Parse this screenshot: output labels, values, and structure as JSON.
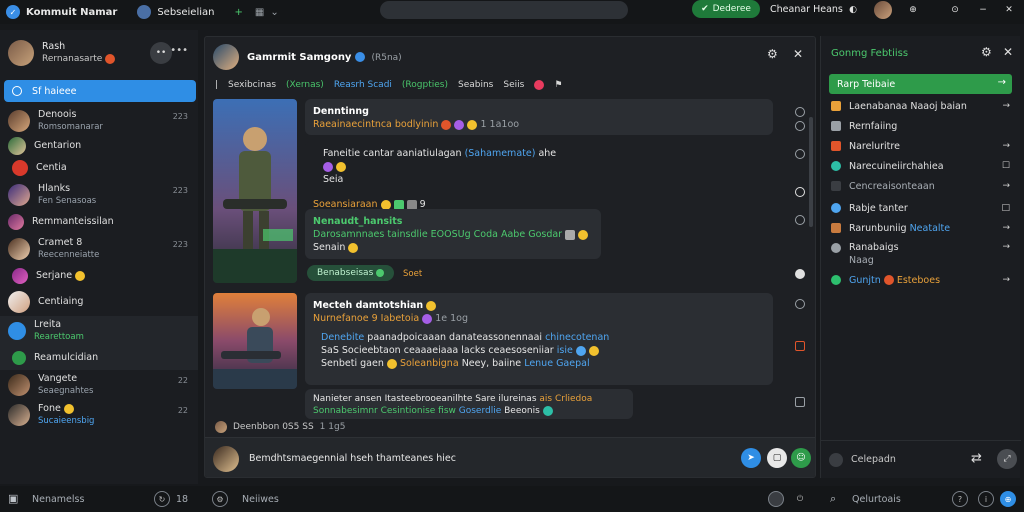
{
  "topbar": {
    "app_title": "Kommuit Namar",
    "server_name": "Sebseielian",
    "green_button": "Dederee",
    "channel_name": "Cheanar Heans"
  },
  "sidebar": {
    "profile_name": "Rash",
    "profile_sub": "Rernanasarte",
    "active_item": "Sf haieee",
    "items": [
      {
        "label": "Denoois",
        "sub": "Romsomanarar",
        "count": "223"
      },
      {
        "label": "Gentarion",
        "sub": "",
        "count": ""
      },
      {
        "label": "Centia",
        "sub": "",
        "count": ""
      },
      {
        "label": "Hlanks",
        "sub": "Fen Senasoas",
        "count": "223"
      },
      {
        "label": "Remmanteissilan",
        "sub": "",
        "count": ""
      },
      {
        "label": "Cramet 8",
        "sub": "Reecenneiatte",
        "count": "223"
      },
      {
        "label": "Serjane",
        "sub": "",
        "count": ""
      },
      {
        "label": "Centiaing",
        "sub": "",
        "count": ""
      },
      {
        "label": "Lreita",
        "sub": "Rearettoam",
        "count": ""
      },
      {
        "label": "Reamulcidian",
        "sub": "",
        "count": ""
      },
      {
        "label": "Vangete",
        "sub": "Seaegnahtes",
        "count": "22"
      },
      {
        "label": "Fone",
        "sub": "Sucaieensbig",
        "count": "22"
      }
    ]
  },
  "bottombar": {
    "left_label": "Nenamelss",
    "count": "18",
    "middle_label": "Neiiwes",
    "right_label": "Qelurtoais"
  },
  "main": {
    "user_name": "Gamrmit Samgony",
    "handle": "(R5na)",
    "tags": [
      "Sexibcinas",
      "(Xernas)",
      "Reasrh Scadi",
      "(Rogpties)",
      "Seabins",
      "Seiis"
    ],
    "post1": {
      "title": "Denntinng",
      "line1": "Raeainaecintnca bodlyinin",
      "line1_tail": "1 1a1oo",
      "body": "Faneitie cantar aaniatiulagan",
      "body_link": "(Sahamemate)",
      "body_tail": "ahe",
      "body_line2": "Seia",
      "footer": "Soeansiaraan",
      "footer_num": "9"
    },
    "post1_reply": {
      "title": "Nenaudt_hansits",
      "line1": "Darosamnnaes tainsdlie EOOSUg Coda Aabe Gosdar",
      "line2": "Senain"
    },
    "post1_pill": "Benabseisas",
    "post1_pill_tail": "Soet",
    "post2": {
      "title": "Mecteh damtotshian",
      "line1": "Nurnefanoe 9 Iabetoia",
      "line1_tail": "1e 1og",
      "body1": "Denebite",
      "body1_tail": "paanadpoicaaan danateassonennaai",
      "body1_link": "chinecotenan",
      "body2": "SaS Socieebtaon ceaaaeiaaa lacks ceaesoseniiar",
      "body2_link": "isie",
      "body3": "Senbeti gaen",
      "body3_mid": "Soleanbigna",
      "body3_tail": "Neey, baiine",
      "body3_link": "Lenue Gaepal"
    },
    "post2_reply": {
      "line1": "Nanieter ansen Itasteebrooeanilhte Sare ilureinas",
      "line1_link": "ais",
      "line1_tail": "Crliedoa",
      "line2": "Sonnabesimnr Cesintionise fisw",
      "line2_link": "Goserdlie",
      "line2_tail": "Beeonis"
    },
    "typing_line": "Deenbbon 0S5 SS",
    "typing_tail": "1 1g5",
    "composer_text": "Bemdhtsmaegennial hseh thamteanes hiec"
  },
  "right": {
    "title": "Gonmg Febtiiss",
    "active": "Rarp Teibaie",
    "items": [
      {
        "label": "Laenabanaa Naaoj baian",
        "sub": "",
        "color": "#e9a13a",
        "action": "→"
      },
      {
        "label": "Rernfaiing",
        "sub": "",
        "color": "#9aa0a6",
        "action": ""
      },
      {
        "label": "Nareluritre",
        "sub": "",
        "color": "#e0552b",
        "action": "→"
      },
      {
        "label": "Narecuineiirchahiea",
        "sub": "",
        "color": "#2dbfa7",
        "action": "☐"
      },
      {
        "label": "Cencreaisonteaan",
        "sub": "",
        "color": "#3a3d42",
        "action": "→"
      },
      {
        "label": "Rabje tanter",
        "sub": "",
        "color": "#4fa5f0",
        "action": "□"
      },
      {
        "label": "Rarunbuniig",
        "sub": "",
        "color": "#c87b3f",
        "action": "→"
      },
      {
        "label": "Ranabaigs",
        "sub": "Naag",
        "color": "#9aa0a6",
        "action": "→"
      },
      {
        "label": "Gunjtn",
        "sub": "",
        "color": "#2dbf6e",
        "action": "→"
      }
    ],
    "item6_link": "Neatalte",
    "item9_link": "Esteboes",
    "footer": "Celepadn"
  },
  "colors": {
    "accent_blue": "#2f8ee5",
    "accent_green": "#2e9b4a"
  }
}
